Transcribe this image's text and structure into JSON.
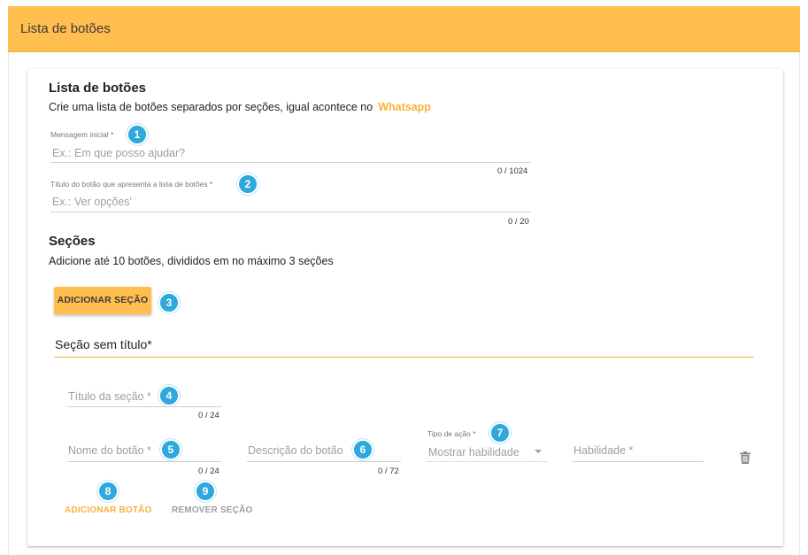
{
  "header": {
    "title": "Lista de botões"
  },
  "card": {
    "title": "Lista de botões",
    "description": "Crie uma lista de botões separados por seções, igual acontece no",
    "whatsapp_link": "Whatsapp",
    "initial_message": {
      "label": "Mensagem inicial *",
      "placeholder": "Ex.: Em que posso ajudar?",
      "counter": "0 / 1024"
    },
    "list_button_title": {
      "label": "Título do botão que apresenta a lista de botões *",
      "placeholder": "Ex.: Ver opções'",
      "counter": "0 / 20"
    },
    "sections_heading": "Seções",
    "sections_description": "Adicione até 10 botões, divididos em no máximo 3 seções",
    "add_section_button": "ADICIONAR SEÇÃO",
    "section": {
      "title": "Seção sem título*",
      "section_title_field": {
        "placeholder": "Título da seção *",
        "counter": "0 / 24"
      },
      "button_name_field": {
        "placeholder": "Nome do botão *",
        "counter": "0 / 24"
      },
      "button_description_field": {
        "placeholder": "Descrição do botão",
        "counter": "0 / 72"
      },
      "action_type_field": {
        "label": "Tipo de ação *",
        "value": "Mostrar habilidade"
      },
      "skill_field": {
        "placeholder": "Habilidade *"
      },
      "add_button": "ADICIONAR BOTÃO",
      "remove_section": "REMOVER SEÇÃO"
    }
  },
  "badges": [
    "1",
    "2",
    "3",
    "4",
    "5",
    "6",
    "7",
    "8",
    "9"
  ],
  "colors": {
    "accent": "#ffbe4d",
    "link": "#f6b33c",
    "badge": "#2ea8dd"
  },
  "icons": {
    "delete": "trash-icon",
    "dropdown": "caret-down-icon"
  }
}
